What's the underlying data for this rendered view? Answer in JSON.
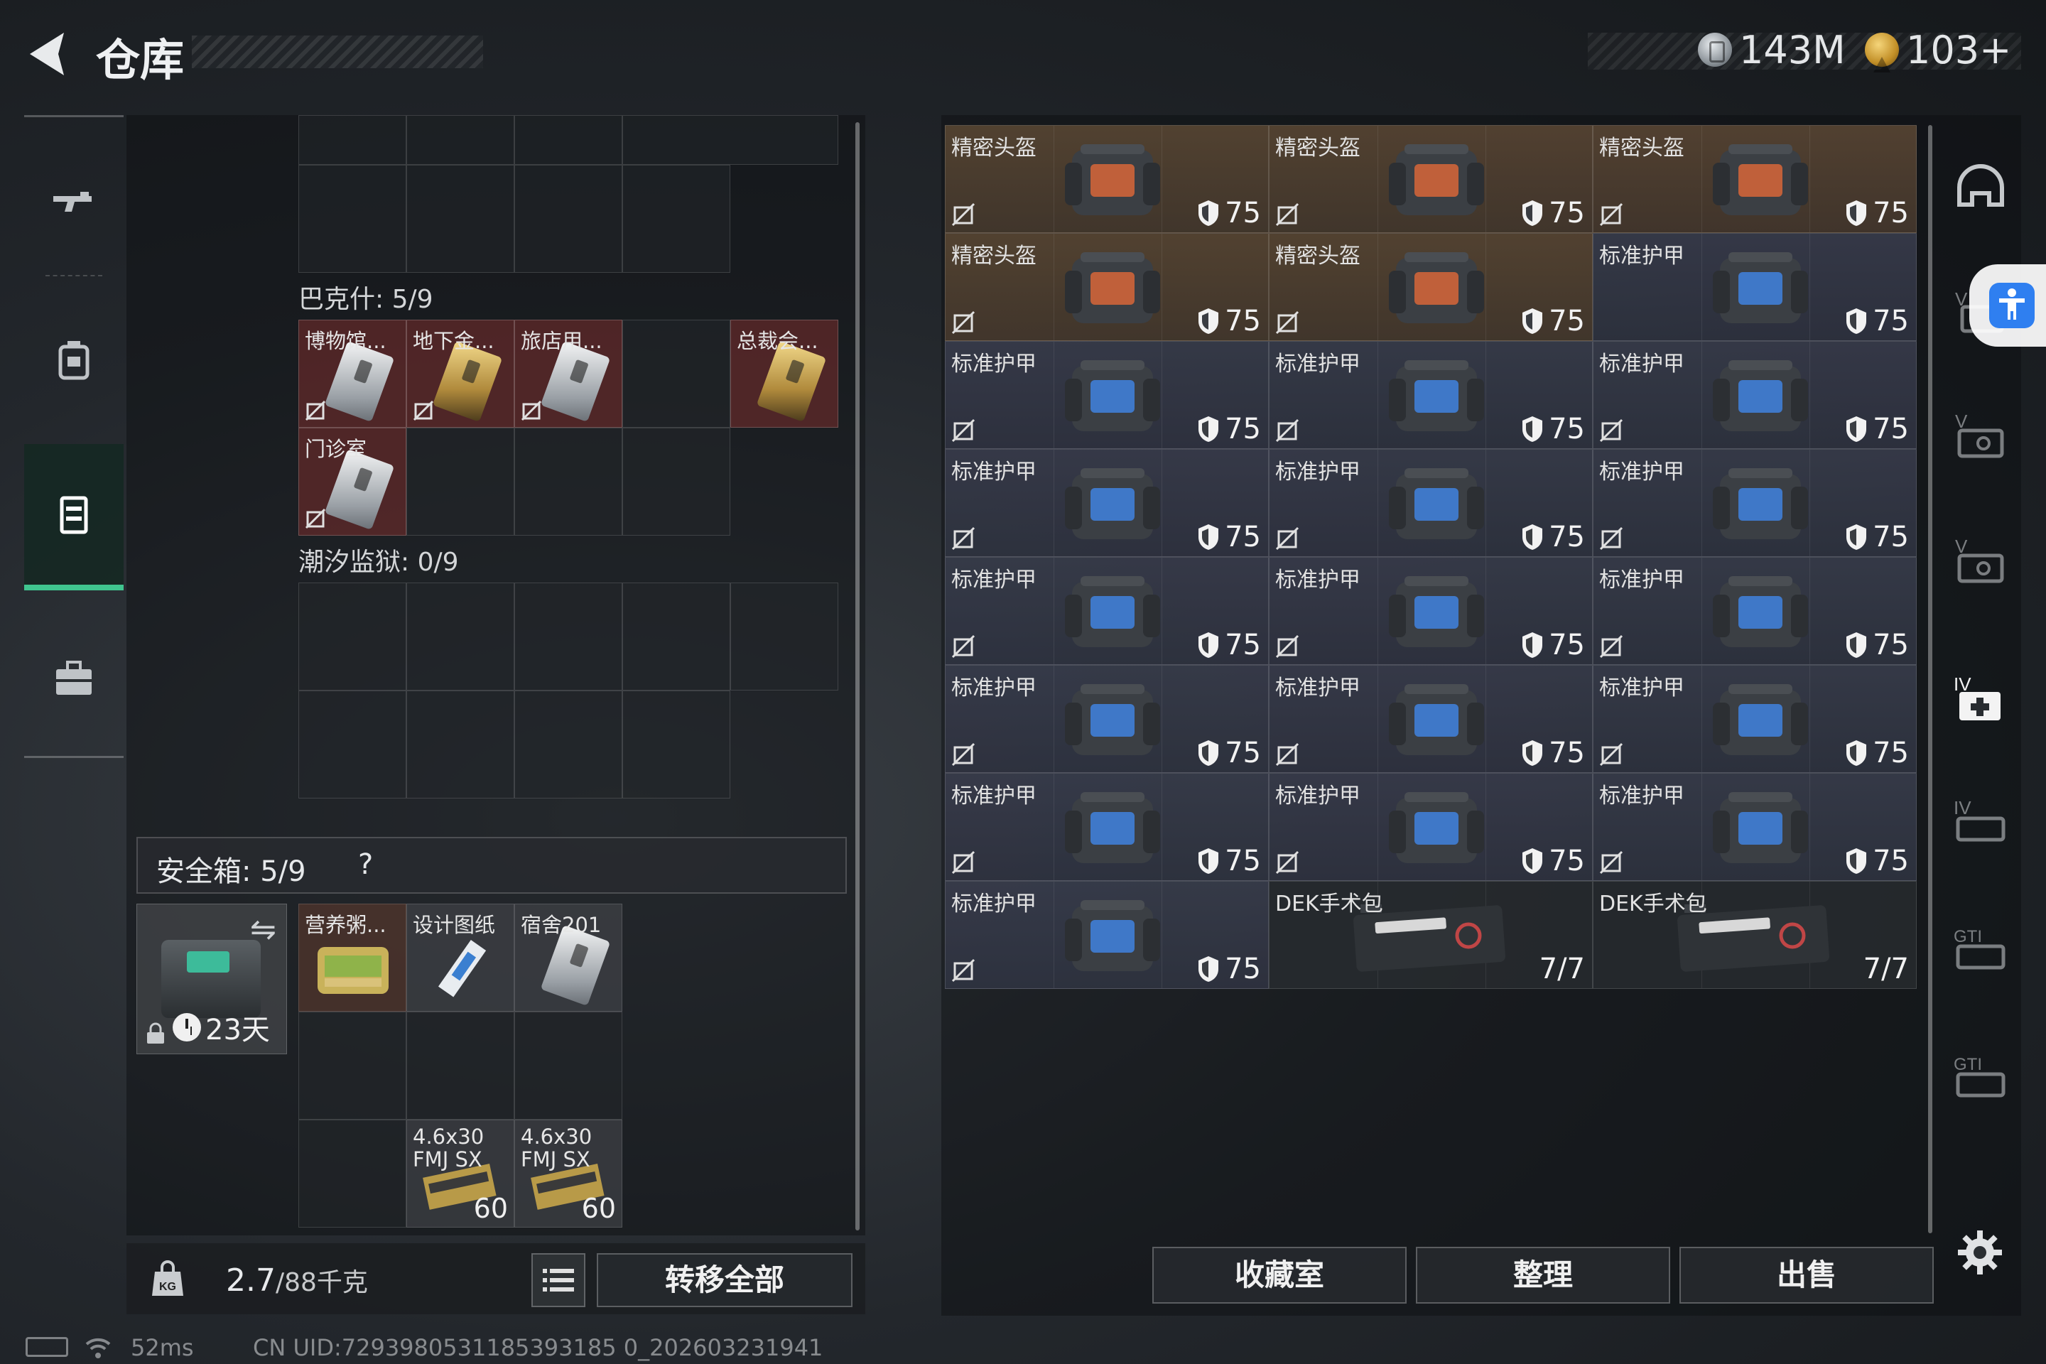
{
  "header": {
    "title": "仓库",
    "currencies": [
      {
        "icon": "silver-coin-icon",
        "value": "143M"
      },
      {
        "icon": "gold-coin-icon",
        "value": "103+"
      }
    ]
  },
  "left_nav": [
    {
      "icon": "rifle-icon"
    },
    {
      "icon": "backpack-icon"
    },
    {
      "icon": "storage-locker-icon",
      "active": true
    },
    {
      "icon": "briefcase-icon"
    }
  ],
  "storage": {
    "sections": [
      {
        "label": "巴克什: 5/9",
        "items": [
          {
            "name": "博物馆...",
            "card": "silver"
          },
          {
            "name": "地下金...",
            "card": "gold"
          },
          {
            "name": "旅店用...",
            "card": "silver"
          },
          {
            "name": "总裁会...",
            "card": "gold"
          },
          {
            "name": "门诊室",
            "card": "silver"
          }
        ]
      },
      {
        "label": "潮汐监狱: 0/9",
        "items": []
      }
    ],
    "safe_box": {
      "label": "安全箱: 5/9",
      "help": "?",
      "duration": "23天",
      "swap_icon": "⇋",
      "items": [
        {
          "name": "营养粥...",
          "kind": "food"
        },
        {
          "name": "设计图纸",
          "kind": "plain"
        },
        {
          "name": "宿舍201",
          "kind": "plain"
        },
        {
          "name": "4.6x30",
          "name2": "FMJ SX",
          "qty": "60"
        },
        {
          "name": "4.6x30",
          "name2": "FMJ SX",
          "qty": "60"
        }
      ]
    },
    "weight": {
      "current": "2.7",
      "rest": "/88千克"
    },
    "transfer_all": "转移全部"
  },
  "inventory": [
    {
      "name": "精密头盔",
      "type": "helmet",
      "value": "75"
    },
    {
      "name": "精密头盔",
      "type": "helmet",
      "value": "75"
    },
    {
      "name": "精密头盔",
      "type": "helmet",
      "value": "75"
    },
    {
      "name": "精密头盔",
      "type": "helmet",
      "value": "75"
    },
    {
      "name": "精密头盔",
      "type": "helmet",
      "value": "75"
    },
    {
      "name": "标准护甲",
      "type": "armor",
      "value": "75"
    },
    {
      "name": "标准护甲",
      "type": "armor",
      "value": "75"
    },
    {
      "name": "标准护甲",
      "type": "armor",
      "value": "75"
    },
    {
      "name": "标准护甲",
      "type": "armor",
      "value": "75"
    },
    {
      "name": "标准护甲",
      "type": "armor",
      "value": "75"
    },
    {
      "name": "标准护甲",
      "type": "armor",
      "value": "75"
    },
    {
      "name": "标准护甲",
      "type": "armor",
      "value": "75"
    },
    {
      "name": "标准护甲",
      "type": "armor",
      "value": "75"
    },
    {
      "name": "标准护甲",
      "type": "armor",
      "value": "75"
    },
    {
      "name": "标准护甲",
      "type": "armor",
      "value": "75"
    },
    {
      "name": "标准护甲",
      "type": "armor",
      "value": "75"
    },
    {
      "name": "标准护甲",
      "type": "armor",
      "value": "75"
    },
    {
      "name": "标准护甲",
      "type": "armor",
      "value": "75"
    },
    {
      "name": "标准护甲",
      "type": "armor",
      "value": "75"
    },
    {
      "name": "标准护甲",
      "type": "armor",
      "value": "75"
    },
    {
      "name": "标准护甲",
      "type": "armor",
      "value": "75"
    },
    {
      "name": "标准护甲",
      "type": "armor",
      "value": "75"
    },
    {
      "name": "DEK手术包",
      "type": "medkit",
      "value": "7/7"
    },
    {
      "name": "DEK手术包",
      "type": "medkit",
      "value": "7/7"
    }
  ],
  "filters": [
    "helmet-filter-icon",
    "armor-filter-icon",
    "helmet-v-filter-icon",
    "helmet-v2-filter-icon",
    "medkit-iv-filter-icon",
    "armor-iv-filter-icon",
    "armor-gti-filter-icon",
    "armor-gti2-filter-icon"
  ],
  "actions": {
    "collection": "收藏室",
    "organize": "整理",
    "sell": "出售"
  },
  "status": {
    "ping": "52ms",
    "uid": "CN UID:7293980531185393185 0_202603231941"
  }
}
